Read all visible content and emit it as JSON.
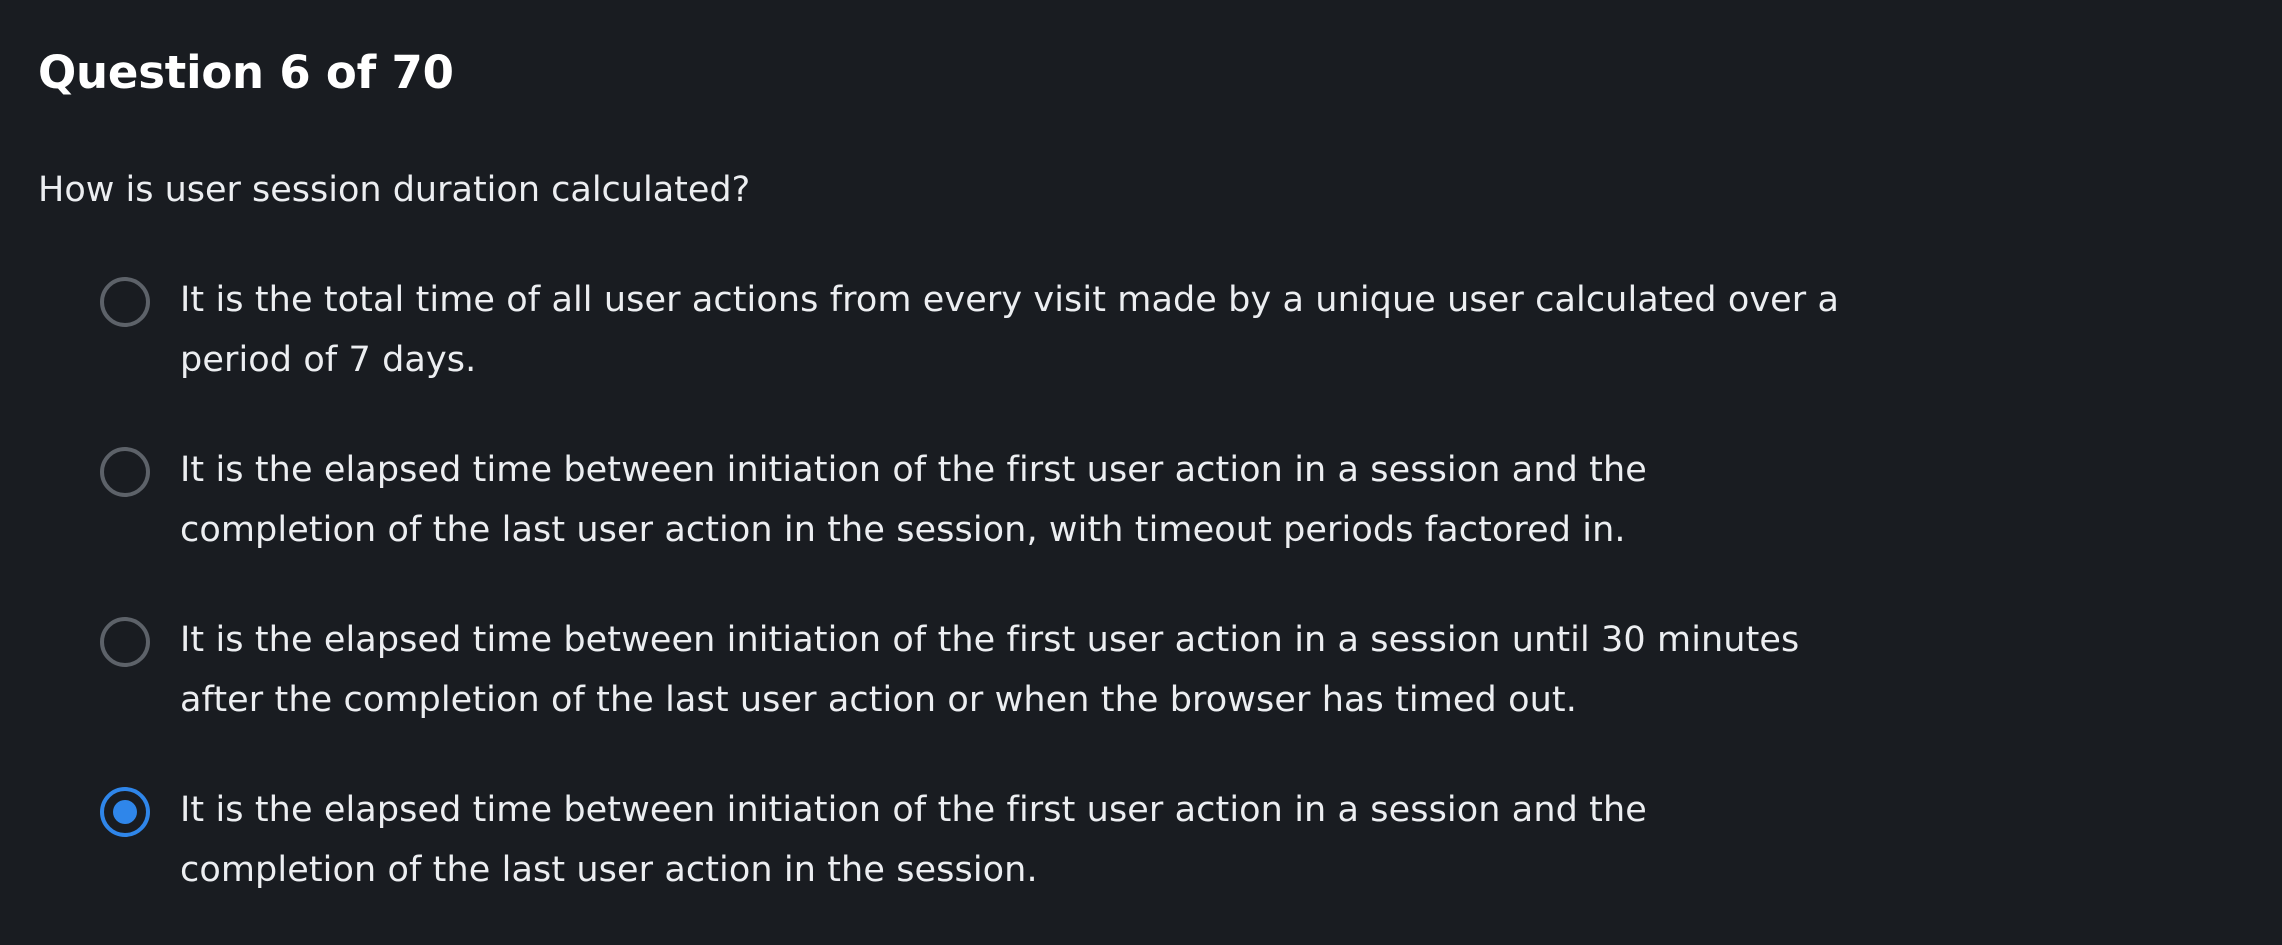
{
  "quiz": {
    "progress_label": "Question 6 of 70",
    "question_text": "How is user session duration calculated?",
    "accent_color": "#2f86ea",
    "options": [
      {
        "line1": "It is the total time of all user actions from every visit made by a unique user calculated over a",
        "line2": "period of 7 days.",
        "selected": false
      },
      {
        "line1": "It is the elapsed time between initiation of the first user action in a session and the",
        "line2": "completion of the last user action in the session, with timeout periods factored in.",
        "selected": false
      },
      {
        "line1": "It is the elapsed time between initiation of the first user action in a session until 30 minutes",
        "line2": "after the completion of the last user action or when the browser has timed out.",
        "selected": false
      },
      {
        "line1": "It is the elapsed time between initiation of the first user action in a session and the",
        "line2": "completion of the last user action in the session.",
        "selected": true
      }
    ]
  }
}
